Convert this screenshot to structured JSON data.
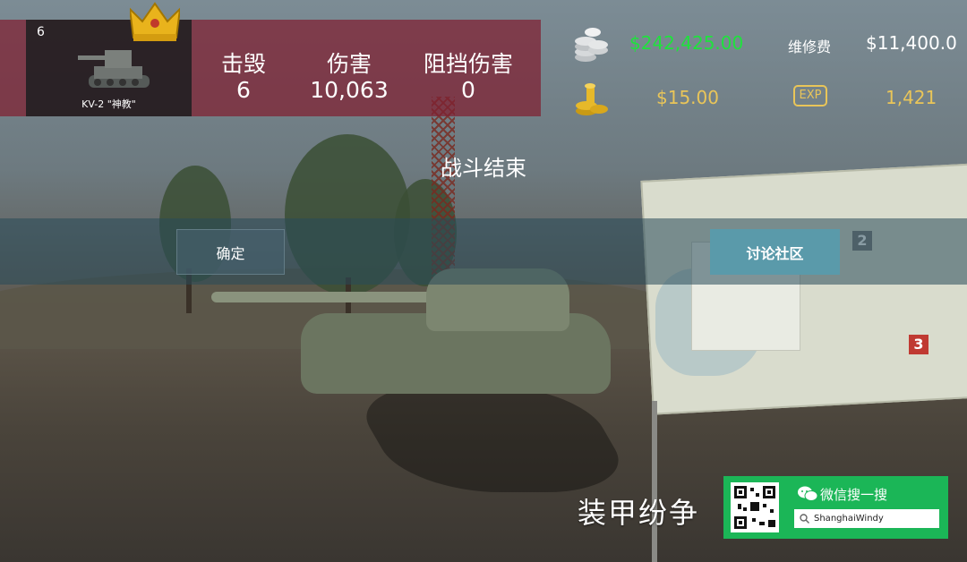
{
  "colors": {
    "money_green": "#1ee33c",
    "gold": "#e9c559",
    "panel_red": "#801e30",
    "forum_button": "#5a9aaa",
    "wechat_green": "#1bb657"
  },
  "tank_card": {
    "tier": "6",
    "name": "KV-2 \"神教\"",
    "icons": [
      "tank-icon",
      "vip-crown-icon"
    ]
  },
  "stats": {
    "headers": [
      "击毁",
      "伤害",
      "阻挡伤害"
    ],
    "values": [
      "6",
      "10,063",
      "0"
    ]
  },
  "rewards": {
    "credits": "$242,425.00",
    "repair_label": "维修费",
    "repair_cost": "$11,400.0",
    "gold": "$15.00",
    "exp_label": "EXP",
    "exp": "1,421",
    "icons": [
      "silver-coins-icon",
      "gold-coins-icon",
      "exp-badge-icon"
    ]
  },
  "dialog": {
    "title": "战斗结束",
    "confirm_label": "确定",
    "forum_label": "讨论社区"
  },
  "scene": {
    "map_numbers": [
      "2",
      "3"
    ]
  },
  "watermark": {
    "brand": "装甲纷争",
    "wechat_title": "微信搜一搜",
    "search_text": "ShanghaiWindy",
    "icons": [
      "qr-code-icon",
      "wechat-icon",
      "search-icon"
    ]
  }
}
